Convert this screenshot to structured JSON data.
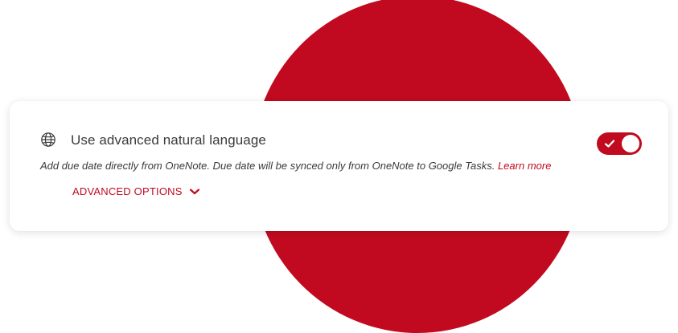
{
  "colors": {
    "accent": "#c10a1f",
    "text": "#3a3a3a",
    "card_background": "#ffffff"
  },
  "setting": {
    "icon": "globe-icon",
    "title": "Use advanced natural language",
    "description": "Add due date directly from OneNote. Due date will be synced only from OneNote to Google Tasks.",
    "learn_more_label": "Learn more",
    "advanced_options_label": "ADVANCED OPTIONS",
    "advanced_options_icon": "chevron-down-icon",
    "toggle_enabled": true,
    "toggle_icon": "check-icon"
  }
}
